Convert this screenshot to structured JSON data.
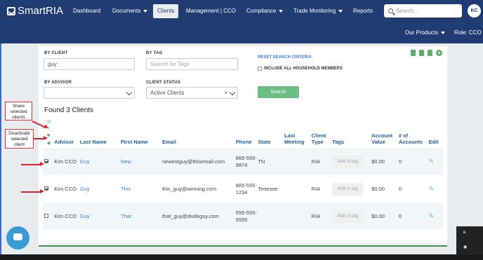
{
  "app": {
    "logo_text": "SmartRIA",
    "accent": "#1f3c73"
  },
  "nav": {
    "dashboard": "Dashboard",
    "documents": "Documents",
    "clients": "Clients",
    "management": "Management | CCO",
    "compliance": "Compliance",
    "trade_monitoring": "Trade Monitoring",
    "reports": "Reports",
    "search_placeholder": "Search...",
    "avatar_initials": "KC"
  },
  "subnav": {
    "products": "Our Products",
    "role": "Role: CCO"
  },
  "filters": {
    "by_client_label": "BY CLIENT",
    "by_client_value": "guy",
    "by_tag_label": "BY TAG",
    "by_tag_placeholder": "Search for Tags",
    "by_advisor_label": "BY ADVISOR",
    "client_status_label": "CLIENT STATUS",
    "client_status_value": "Active Clients",
    "reset_label": "RESET SEARCH CRITERIA",
    "household_label": "INCLUDE ALL HOUSEHOLD MEMBERS",
    "search_button": "Search"
  },
  "results": {
    "found_text": "Found 3 Clients",
    "columns": [
      "Advisor",
      "Last Name",
      "First Name",
      "Email",
      "Phone",
      "State",
      "Last Meeting",
      "Client Type",
      "Tags",
      "Account Value",
      "# of Accounts",
      "Edit"
    ],
    "rows": [
      {
        "checked": true,
        "advisor": "Kim CCO",
        "last": "Guy",
        "first": "New",
        "email": "newestguy@thisemail.com",
        "phone": "865-555-9874",
        "state": "TN",
        "meeting": "",
        "type": "RIA",
        "tag": "Add a tag",
        "value": "$0.00",
        "accounts": "0"
      },
      {
        "checked": true,
        "advisor": "Kim CCO",
        "last": "Guy",
        "first": "This",
        "email": "this_guy@winning.com",
        "phone": "865-555-1234",
        "state": "Tenesee",
        "meeting": "",
        "type": "RIA",
        "tag": "Add a tag",
        "value": "$0.00",
        "accounts": "0"
      },
      {
        "checked": false,
        "advisor": "Kim CCO",
        "last": "Guy",
        "first": "That",
        "email": "that_guy@dudeguy.com",
        "phone": "555-555-5555",
        "state": "",
        "meeting": "",
        "type": "RIA",
        "tag": "Add a tag",
        "value": "$0.00",
        "accounts": "0"
      }
    ]
  },
  "callouts": {
    "share": "Share selected clients",
    "deactivate": "Deactivate selected client"
  }
}
